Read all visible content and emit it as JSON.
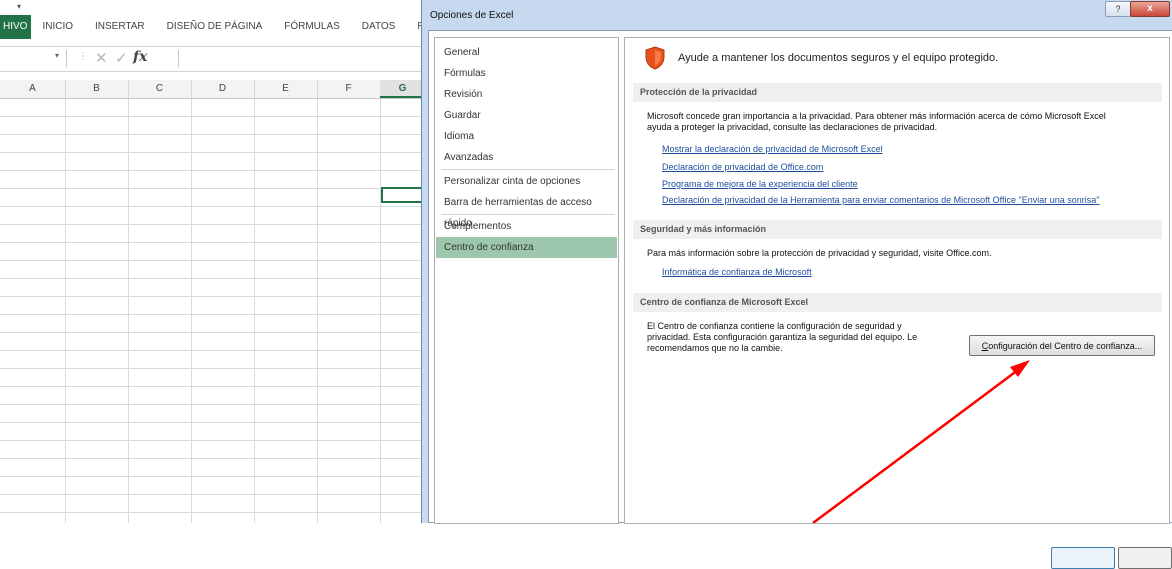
{
  "excel": {
    "ribbon_tabs": [
      "HIVO",
      "INICIO",
      "INSERTAR",
      "DISEÑO DE PÁGINA",
      "FÓRMULAS",
      "DATOS",
      "REVISAR"
    ],
    "formula_bar": {
      "fx_label": "fx"
    },
    "columns": [
      "A",
      "B",
      "C",
      "D",
      "E",
      "F",
      "G"
    ],
    "selected_column": "G"
  },
  "dialog": {
    "title": "Opciones de Excel",
    "help_label": "?",
    "close_label": "x",
    "nav": [
      "General",
      "Fórmulas",
      "Revisión",
      "Guardar",
      "Idioma",
      "Avanzadas",
      "Personalizar cinta de opciones",
      "Barra de herramientas de acceso rápido",
      "Complementos",
      "Centro de confianza"
    ],
    "active_nav": "Centro de confianza",
    "header_text": "Ayude a mantener los documentos seguros y el equipo protegido.",
    "privacy": {
      "heading": "Protección de la privacidad",
      "text_line1": "Microsoft concede gran importancia a la privacidad. Para obtener más información acerca de cómo Microsoft Excel",
      "text_line2": "ayuda a proteger la privacidad, consulte las declaraciones de privacidad.",
      "links": [
        "Mostrar la declaración de privacidad de Microsoft Excel",
        "Declaración de privacidad de Office.com",
        "Programa de mejora de la experiencia del cliente",
        "Declaración de privacidad de la Herramienta para enviar comentarios de Microsoft Office \"Enviar una sonrisa\""
      ]
    },
    "security": {
      "heading": "Seguridad y más información",
      "text": "Para más información sobre la protección de privacidad y seguridad, visite Office.com.",
      "link": "Informática de confianza de Microsoft"
    },
    "trust_center": {
      "heading": "Centro de confianza de Microsoft Excel",
      "text_line1": "El Centro de confianza contiene la configuración de seguridad y",
      "text_line2": "privacidad. Esta configuración garantiza la seguridad del equipo. Le",
      "text_line3": "recomendamos que no la cambie.",
      "button_first": "C",
      "button_rest": "onfiguración del Centro de confianza..."
    }
  },
  "colors": {
    "excel_green": "#217346",
    "active_nav": "#9dc7ad",
    "link": "#1e4e9a",
    "annotation_arrow": "#ff0000",
    "shield": "#e8501e"
  }
}
